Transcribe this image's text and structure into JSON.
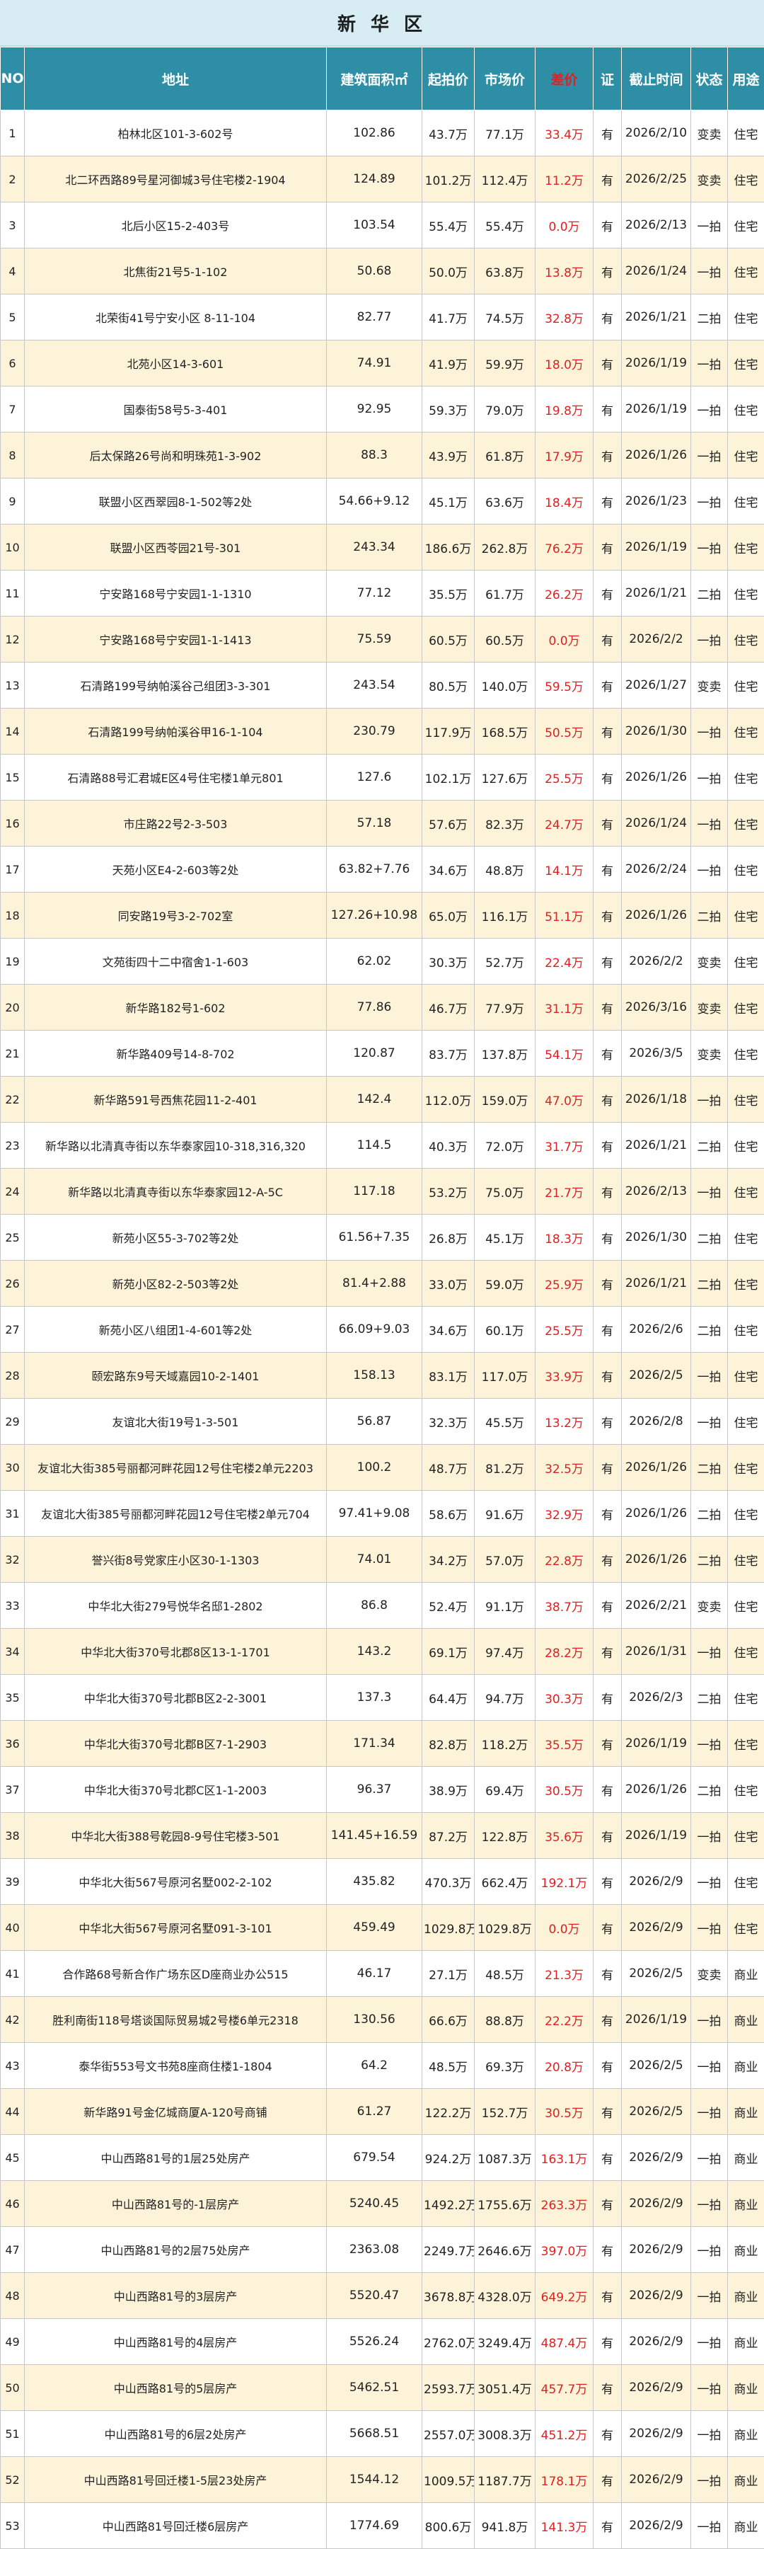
{
  "title": "新 华 区",
  "headers": {
    "no": "NO",
    "address": "地址",
    "area": "建筑面积㎡",
    "start": "起拍价",
    "market": "市场价",
    "diff": "差价",
    "cert": "证",
    "date": "截止时间",
    "status": "状态",
    "use": "用途"
  },
  "rows": [
    {
      "no": "1",
      "address": "柏林北区101-3-602号",
      "area": "102.86",
      "start": "43.7万",
      "market": "77.1万",
      "diff": "33.4万",
      "cert": "有",
      "date": "2026/2/10",
      "status": "变卖",
      "use": "住宅"
    },
    {
      "no": "2",
      "address": "北二环西路89号星河御城3号住宅楼2-1904",
      "area": "124.89",
      "start": "101.2万",
      "market": "112.4万",
      "diff": "11.2万",
      "cert": "有",
      "date": "2026/2/25",
      "status": "变卖",
      "use": "住宅"
    },
    {
      "no": "3",
      "address": "北后小区15-2-403号",
      "area": "103.54",
      "start": "55.4万",
      "market": "55.4万",
      "diff": "0.0万",
      "cert": "有",
      "date": "2026/2/13",
      "status": "一拍",
      "use": "住宅"
    },
    {
      "no": "4",
      "address": "北焦街21号5-1-102",
      "area": "50.68",
      "start": "50.0万",
      "market": "63.8万",
      "diff": "13.8万",
      "cert": "有",
      "date": "2026/1/24",
      "status": "一拍",
      "use": "住宅"
    },
    {
      "no": "5",
      "address": "北荣街41号宁安小区 8-11-104",
      "area": "82.77",
      "start": "41.7万",
      "market": "74.5万",
      "diff": "32.8万",
      "cert": "有",
      "date": "2026/1/21",
      "status": "二拍",
      "use": "住宅"
    },
    {
      "no": "6",
      "address": "北苑小区14-3-601",
      "area": "74.91",
      "start": "41.9万",
      "market": "59.9万",
      "diff": "18.0万",
      "cert": "有",
      "date": "2026/1/19",
      "status": "一拍",
      "use": "住宅"
    },
    {
      "no": "7",
      "address": "国泰街58号5-3-401",
      "area": "92.95",
      "start": "59.3万",
      "market": "79.0万",
      "diff": "19.8万",
      "cert": "有",
      "date": "2026/1/19",
      "status": "一拍",
      "use": "住宅"
    },
    {
      "no": "8",
      "address": "后太保路26号尚和明珠苑1-3-902",
      "area": "88.3",
      "start": "43.9万",
      "market": "61.8万",
      "diff": "17.9万",
      "cert": "有",
      "date": "2026/1/26",
      "status": "一拍",
      "use": "住宅"
    },
    {
      "no": "9",
      "address": "联盟小区西翠园8-1-502等2处",
      "area": "54.66+9.12",
      "start": "45.1万",
      "market": "63.6万",
      "diff": "18.4万",
      "cert": "有",
      "date": "2026/1/23",
      "status": "一拍",
      "use": "住宅"
    },
    {
      "no": "10",
      "address": "联盟小区西苓园21号-301",
      "area": "243.34",
      "start": "186.6万",
      "market": "262.8万",
      "diff": "76.2万",
      "cert": "有",
      "date": "2026/1/19",
      "status": "一拍",
      "use": "住宅"
    },
    {
      "no": "11",
      "address": "宁安路168号宁安园1-1-1310",
      "area": "77.12",
      "start": "35.5万",
      "market": "61.7万",
      "diff": "26.2万",
      "cert": "有",
      "date": "2026/1/21",
      "status": "二拍",
      "use": "住宅"
    },
    {
      "no": "12",
      "address": "宁安路168号宁安园1-1-1413",
      "area": "75.59",
      "start": "60.5万",
      "market": "60.5万",
      "diff": "0.0万",
      "cert": "有",
      "date": "2026/2/2",
      "status": "一拍",
      "use": "住宅"
    },
    {
      "no": "13",
      "address": "石清路199号纳帕溪谷己组团3-3-301",
      "area": "243.54",
      "start": "80.5万",
      "market": "140.0万",
      "diff": "59.5万",
      "cert": "有",
      "date": "2026/1/27",
      "status": "变卖",
      "use": "住宅"
    },
    {
      "no": "14",
      "address": "石清路199号纳帕溪谷甲16-1-104",
      "area": "230.79",
      "start": "117.9万",
      "market": "168.5万",
      "diff": "50.5万",
      "cert": "有",
      "date": "2026/1/30",
      "status": "一拍",
      "use": "住宅"
    },
    {
      "no": "15",
      "address": "石清路88号汇君城E区4号住宅楼1单元801",
      "area": "127.6",
      "start": "102.1万",
      "market": "127.6万",
      "diff": "25.5万",
      "cert": "有",
      "date": "2026/1/26",
      "status": "一拍",
      "use": "住宅"
    },
    {
      "no": "16",
      "address": "市庄路22号2-3-503",
      "area": "57.18",
      "start": "57.6万",
      "market": "82.3万",
      "diff": "24.7万",
      "cert": "有",
      "date": "2026/1/24",
      "status": "一拍",
      "use": "住宅"
    },
    {
      "no": "17",
      "address": "天苑小区E4-2-603等2处",
      "area": "63.82+7.76",
      "start": "34.6万",
      "market": "48.8万",
      "diff": "14.1万",
      "cert": "有",
      "date": "2026/2/24",
      "status": "一拍",
      "use": "住宅"
    },
    {
      "no": "18",
      "address": "同安路19号3-2-702室",
      "area": "127.26+10.98",
      "start": "65.0万",
      "market": "116.1万",
      "diff": "51.1万",
      "cert": "有",
      "date": "2026/1/26",
      "status": "二拍",
      "use": "住宅"
    },
    {
      "no": "19",
      "address": "文苑街四十二中宿舍1-1-603",
      "area": "62.02",
      "start": "30.3万",
      "market": "52.7万",
      "diff": "22.4万",
      "cert": "有",
      "date": "2026/2/2",
      "status": "变卖",
      "use": "住宅"
    },
    {
      "no": "20",
      "address": "新华路182号1-602",
      "area": "77.86",
      "start": "46.7万",
      "market": "77.9万",
      "diff": "31.1万",
      "cert": "有",
      "date": "2026/3/16",
      "status": "变卖",
      "use": "住宅"
    },
    {
      "no": "21",
      "address": "新华路409号14-8-702",
      "area": "120.87",
      "start": "83.7万",
      "market": "137.8万",
      "diff": "54.1万",
      "cert": "有",
      "date": "2026/3/5",
      "status": "变卖",
      "use": "住宅"
    },
    {
      "no": "22",
      "address": "新华路591号西焦花园11-2-401",
      "area": "142.4",
      "start": "112.0万",
      "market": "159.0万",
      "diff": "47.0万",
      "cert": "有",
      "date": "2026/1/18",
      "status": "一拍",
      "use": "住宅"
    },
    {
      "no": "23",
      "address": "新华路以北清真寺街以东华泰家园10-318,316,320",
      "area": "114.5",
      "start": "40.3万",
      "market": "72.0万",
      "diff": "31.7万",
      "cert": "有",
      "date": "2026/1/21",
      "status": "二拍",
      "use": "住宅"
    },
    {
      "no": "24",
      "address": "新华路以北清真寺街以东华泰家园12-A-5C",
      "area": "117.18",
      "start": "53.2万",
      "market": "75.0万",
      "diff": "21.7万",
      "cert": "有",
      "date": "2026/2/13",
      "status": "一拍",
      "use": "住宅"
    },
    {
      "no": "25",
      "address": "新苑小区55-3-702等2处",
      "area": "61.56+7.35",
      "start": "26.8万",
      "market": "45.1万",
      "diff": "18.3万",
      "cert": "有",
      "date": "2026/1/30",
      "status": "二拍",
      "use": "住宅"
    },
    {
      "no": "26",
      "address": "新苑小区82-2-503等2处",
      "area": "81.4+2.88",
      "start": "33.0万",
      "market": "59.0万",
      "diff": "25.9万",
      "cert": "有",
      "date": "2026/1/21",
      "status": "二拍",
      "use": "住宅"
    },
    {
      "no": "27",
      "address": "新苑小区八组团1-4-601等2处",
      "area": "66.09+9.03",
      "start": "34.6万",
      "market": "60.1万",
      "diff": "25.5万",
      "cert": "有",
      "date": "2026/2/6",
      "status": "二拍",
      "use": "住宅"
    },
    {
      "no": "28",
      "address": "颐宏路东9号天域嘉园10-2-1401",
      "area": "158.13",
      "start": "83.1万",
      "market": "117.0万",
      "diff": "33.9万",
      "cert": "有",
      "date": "2026/2/5",
      "status": "一拍",
      "use": "住宅"
    },
    {
      "no": "29",
      "address": "友谊北大街19号1-3-501",
      "area": "56.87",
      "start": "32.3万",
      "market": "45.5万",
      "diff": "13.2万",
      "cert": "有",
      "date": "2026/2/8",
      "status": "一拍",
      "use": "住宅"
    },
    {
      "no": "30",
      "address": "友谊北大街385号丽都河畔花园12号住宅楼2单元2203",
      "area": "100.2",
      "start": "48.7万",
      "market": "81.2万",
      "diff": "32.5万",
      "cert": "有",
      "date": "2026/1/26",
      "status": "二拍",
      "use": "住宅"
    },
    {
      "no": "31",
      "address": "友谊北大街385号丽都河畔花园12号住宅楼2单元704",
      "area": "97.41+9.08",
      "start": "58.6万",
      "market": "91.6万",
      "diff": "32.9万",
      "cert": "有",
      "date": "2026/1/26",
      "status": "二拍",
      "use": "住宅"
    },
    {
      "no": "32",
      "address": "誉兴街8号党家庄小区30-1-1303",
      "area": "74.01",
      "start": "34.2万",
      "market": "57.0万",
      "diff": "22.8万",
      "cert": "有",
      "date": "2026/1/26",
      "status": "二拍",
      "use": "住宅"
    },
    {
      "no": "33",
      "address": "中华北大街279号悦华名邸1-2802",
      "area": "86.8",
      "start": "52.4万",
      "market": "91.1万",
      "diff": "38.7万",
      "cert": "有",
      "date": "2026/2/21",
      "status": "变卖",
      "use": "住宅"
    },
    {
      "no": "34",
      "address": "中华北大街370号北郡8区13-1-1701",
      "area": "143.2",
      "start": "69.1万",
      "market": "97.4万",
      "diff": "28.2万",
      "cert": "有",
      "date": "2026/1/31",
      "status": "一拍",
      "use": "住宅"
    },
    {
      "no": "35",
      "address": "中华北大街370号北郡B区2-2-3001",
      "area": "137.3",
      "start": "64.4万",
      "market": "94.7万",
      "diff": "30.3万",
      "cert": "有",
      "date": "2026/2/3",
      "status": "二拍",
      "use": "住宅"
    },
    {
      "no": "36",
      "address": "中华北大街370号北郡B区7-1-2903",
      "area": "171.34",
      "start": "82.8万",
      "market": "118.2万",
      "diff": "35.5万",
      "cert": "有",
      "date": "2026/1/19",
      "status": "一拍",
      "use": "住宅"
    },
    {
      "no": "37",
      "address": "中华北大街370号北郡C区1-1-2003",
      "area": "96.37",
      "start": "38.9万",
      "market": "69.4万",
      "diff": "30.5万",
      "cert": "有",
      "date": "2026/1/26",
      "status": "二拍",
      "use": "住宅"
    },
    {
      "no": "38",
      "address": "中华北大街388号乾园8-9号住宅楼3-501",
      "area": "141.45+16.59",
      "start": "87.2万",
      "market": "122.8万",
      "diff": "35.6万",
      "cert": "有",
      "date": "2026/1/19",
      "status": "一拍",
      "use": "住宅"
    },
    {
      "no": "39",
      "address": "中华北大街567号原河名墅002-2-102",
      "area": "435.82",
      "start": "470.3万",
      "market": "662.4万",
      "diff": "192.1万",
      "cert": "有",
      "date": "2026/2/9",
      "status": "一拍",
      "use": "住宅"
    },
    {
      "no": "40",
      "address": "中华北大街567号原河名墅091-3-101",
      "area": "459.49",
      "start": "1029.8万",
      "market": "1029.8万",
      "diff": "0.0万",
      "cert": "有",
      "date": "2026/2/9",
      "status": "一拍",
      "use": "住宅"
    },
    {
      "no": "41",
      "address": "合作路68号新合作广场东区D座商业办公515",
      "area": "46.17",
      "start": "27.1万",
      "market": "48.5万",
      "diff": "21.3万",
      "cert": "有",
      "date": "2026/2/5",
      "status": "变卖",
      "use": "商业"
    },
    {
      "no": "42",
      "address": "胜利南街118号塔谈国际贸易城2号楼6单元2318",
      "area": "130.56",
      "start": "66.6万",
      "market": "88.8万",
      "diff": "22.2万",
      "cert": "有",
      "date": "2026/1/19",
      "status": "一拍",
      "use": "商业"
    },
    {
      "no": "43",
      "address": "泰华街553号文书苑8座商住楼1-1804",
      "area": "64.2",
      "start": "48.5万",
      "market": "69.3万",
      "diff": "20.8万",
      "cert": "有",
      "date": "2026/2/5",
      "status": "一拍",
      "use": "商业"
    },
    {
      "no": "44",
      "address": "新华路91号金亿城商厦A-120号商铺",
      "area": "61.27",
      "start": "122.2万",
      "market": "152.7万",
      "diff": "30.5万",
      "cert": "有",
      "date": "2026/2/5",
      "status": "一拍",
      "use": "商业"
    },
    {
      "no": "45",
      "address": "中山西路81号的1层25处房产",
      "area": "679.54",
      "start": "924.2万",
      "market": "1087.3万",
      "diff": "163.1万",
      "cert": "有",
      "date": "2026/2/9",
      "status": "一拍",
      "use": "商业"
    },
    {
      "no": "46",
      "address": "中山西路81号的-1层房产",
      "area": "5240.45",
      "start": "1492.2万",
      "market": "1755.6万",
      "diff": "263.3万",
      "cert": "有",
      "date": "2026/2/9",
      "status": "一拍",
      "use": "商业"
    },
    {
      "no": "47",
      "address": "中山西路81号的2层75处房产",
      "area": "2363.08",
      "start": "2249.7万",
      "market": "2646.6万",
      "diff": "397.0万",
      "cert": "有",
      "date": "2026/2/9",
      "status": "一拍",
      "use": "商业"
    },
    {
      "no": "48",
      "address": "中山西路81号的3层房产",
      "area": "5520.47",
      "start": "3678.8万",
      "market": "4328.0万",
      "diff": "649.2万",
      "cert": "有",
      "date": "2026/2/9",
      "status": "一拍",
      "use": "商业"
    },
    {
      "no": "49",
      "address": "中山西路81号的4层房产",
      "area": "5526.24",
      "start": "2762.0万",
      "market": "3249.4万",
      "diff": "487.4万",
      "cert": "有",
      "date": "2026/2/9",
      "status": "一拍",
      "use": "商业"
    },
    {
      "no": "50",
      "address": "中山西路81号的5层房产",
      "area": "5462.51",
      "start": "2593.7万",
      "market": "3051.4万",
      "diff": "457.7万",
      "cert": "有",
      "date": "2026/2/9",
      "status": "一拍",
      "use": "商业"
    },
    {
      "no": "51",
      "address": "中山西路81号的6层2处房产",
      "area": "5668.51",
      "start": "2557.0万",
      "market": "3008.3万",
      "diff": "451.2万",
      "cert": "有",
      "date": "2026/2/9",
      "status": "一拍",
      "use": "商业"
    },
    {
      "no": "52",
      "address": "中山西路81号回迁楼1-5层23处房产",
      "area": "1544.12",
      "start": "1009.5万",
      "market": "1187.7万",
      "diff": "178.1万",
      "cert": "有",
      "date": "2026/2/9",
      "status": "一拍",
      "use": "商业"
    },
    {
      "no": "53",
      "address": "中山西路81号回迁楼6层房产",
      "area": "1774.69",
      "start": "800.6万",
      "market": "941.8万",
      "diff": "141.3万",
      "cert": "有",
      "date": "2026/2/9",
      "status": "一拍",
      "use": "商业"
    }
  ]
}
